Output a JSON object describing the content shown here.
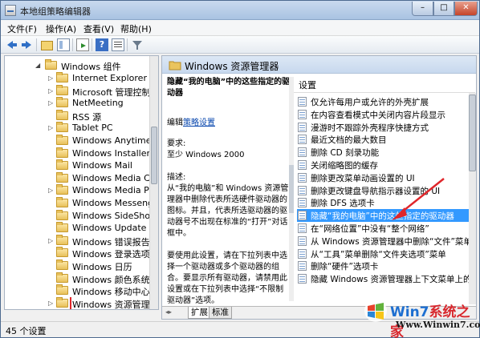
{
  "window": {
    "title": "本地组策略编辑器",
    "min": "–",
    "max": "□",
    "close": "✕"
  },
  "menu": [
    "文件(F)",
    "操作(A)",
    "查看(V)",
    "帮助(H)"
  ],
  "toolbar": {
    "help_label": "?"
  },
  "tree": {
    "root": "Windows 组件",
    "items": [
      {
        "label": "Internet Explorer",
        "expandable": true
      },
      {
        "label": "Microsoft 管理控制台",
        "expandable": true
      },
      {
        "label": "NetMeeting",
        "expandable": true
      },
      {
        "label": "RSS 源",
        "expandable": false
      },
      {
        "label": "Tablet PC",
        "expandable": true
      },
      {
        "label": "Windows Anytime Up",
        "expandable": false
      },
      {
        "label": "Windows Installer",
        "expandable": false
      },
      {
        "label": "Windows Mail",
        "expandable": false
      },
      {
        "label": "Windows Media Cent",
        "expandable": false
      },
      {
        "label": "Windows Media Playe",
        "expandable": true
      },
      {
        "label": "Windows Messenger",
        "expandable": false
      },
      {
        "label": "Windows SideShow",
        "expandable": false
      },
      {
        "label": "Windows Update",
        "expandable": false
      },
      {
        "label": "Windows 错误报告",
        "expandable": true
      },
      {
        "label": "Windows 登录选项",
        "expandable": false
      },
      {
        "label": "Windows 日历",
        "expandable": false
      },
      {
        "label": "Windows 颜色系统",
        "expandable": false
      },
      {
        "label": "Windows 移动中心",
        "expandable": false
      },
      {
        "label": "Windows 资源管理器",
        "expandable": true,
        "selected": true
      }
    ]
  },
  "right": {
    "header": "Windows 资源管理器",
    "description": {
      "title": "隐藏“我的电脑”中的这些指定的驱动器",
      "edit_prefix": "编辑",
      "edit_link": "策略设置",
      "req_label": "要求:",
      "req_value": "至少 Windows 2000",
      "desc_label": "描述:",
      "desc_text": "从“我的电脑”和 Windows 资源管理器中删除代表所选硬件驱动器的图标。并且，代表所选驱动器的驱动器号不出现在标准的“打开”对话框中。",
      "usage_text": "要使用此设置，请在下拉列表中选择一个驱动器或多个驱动器的组合。要显示所有驱动器，请禁用此设置或在下拉列表中选择“不限制驱动器”选项。"
    },
    "list_header": "设置",
    "settings": [
      {
        "label": "仅允许每用户或允许的外壳扩展"
      },
      {
        "label": "在内容查看模式中关闭内容片段显示"
      },
      {
        "label": "漫游时不跟踪外壳程序快捷方式"
      },
      {
        "label": "最近文档的最大数目"
      },
      {
        "label": "删除 CD 刻录功能"
      },
      {
        "label": "关闭缩略图的缓存"
      },
      {
        "label": "删除更改菜单动画设置的 UI"
      },
      {
        "label": "删除更改键盘导航指示器设置的 UI"
      },
      {
        "label": "删除 DFS 选项卡"
      },
      {
        "label": "隐藏“我的电脑”中的这些指定的驱动器",
        "selected": true
      },
      {
        "label": "在“网络位置”中没有“整个网络”"
      },
      {
        "label": "从 Windows 资源管理器中删除“文件”菜单"
      },
      {
        "label": "从“工具”菜单删除“文件夹选项”菜单"
      },
      {
        "label": "删除“硬件”选项卡"
      },
      {
        "label": "隐藏 Windows 资源管理器上下文菜单上的“管"
      }
    ],
    "tabs": [
      "扩展",
      "标准"
    ],
    "tab_arrows": "◂▸"
  },
  "status": "45 个设置",
  "watermark": {
    "brand_a": "Win7",
    "brand_b": "系统之家",
    "url": "Www.Winwin7.com"
  },
  "colors": {
    "selection": "#3399ff",
    "highlight_box": "#e0262b",
    "arrow": "#e0262b"
  }
}
